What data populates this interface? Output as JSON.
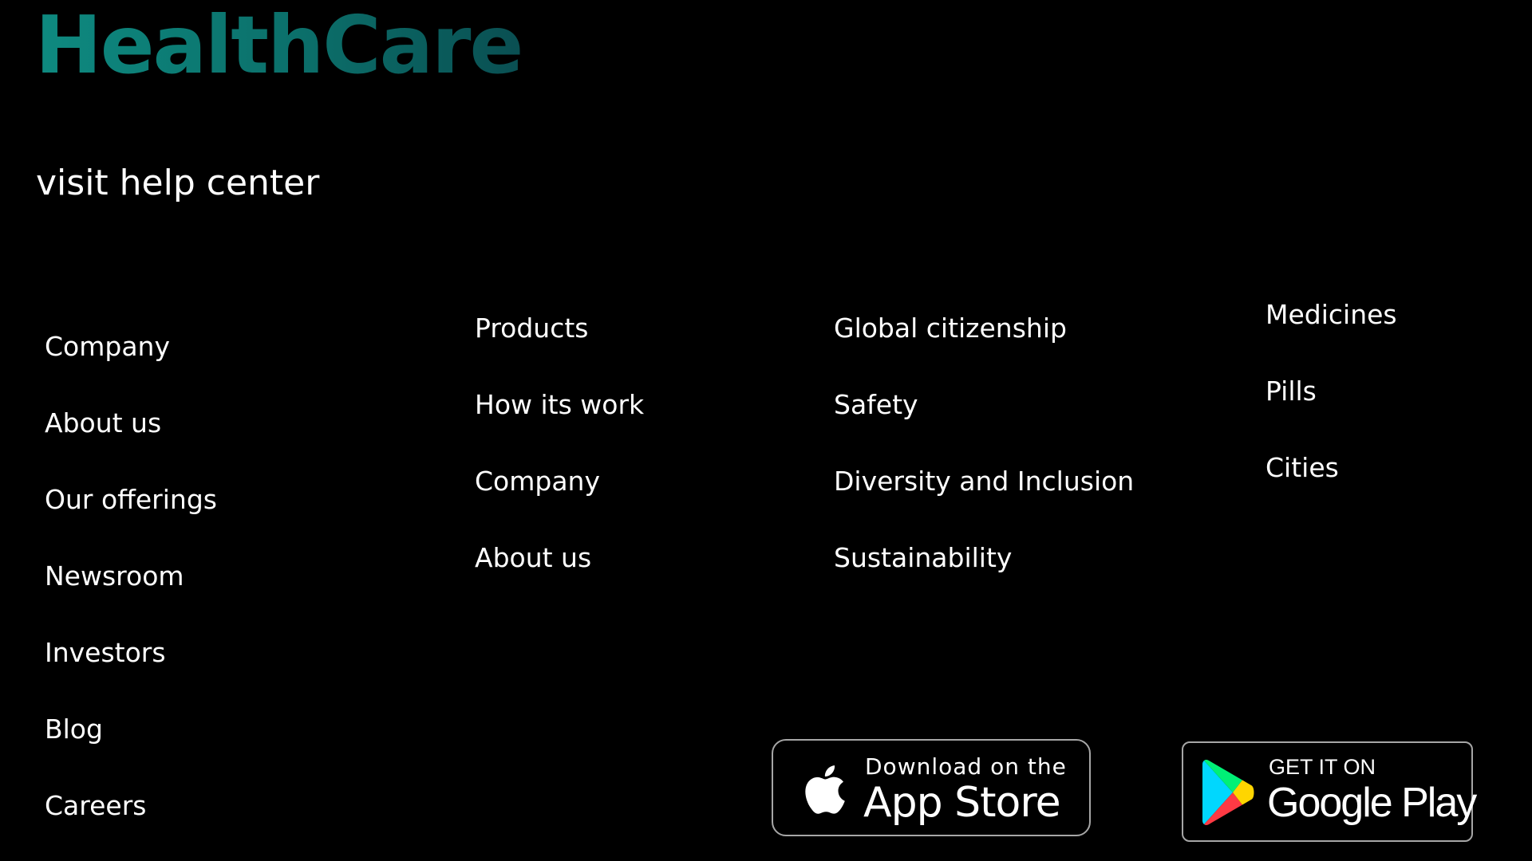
{
  "brand": {
    "name": "HealthCare",
    "gradient_start": "#0e8a80",
    "gradient_end": "#0a4f52"
  },
  "help": {
    "label": "visit help center"
  },
  "footer": {
    "columns": [
      {
        "items": [
          "Company",
          "About us",
          "Our offerings",
          "Newsroom",
          "Investors",
          "Blog",
          "Careers"
        ]
      },
      {
        "items": [
          "Products",
          "How its work",
          "Company",
          "About us"
        ]
      },
      {
        "items": [
          "Global citizenship",
          "Safety",
          "Diversity and Inclusion",
          "Sustainability"
        ]
      },
      {
        "items": [
          "Medicines",
          "Pills",
          "Cities"
        ]
      }
    ]
  },
  "stores": {
    "app_store": {
      "icon": "apple-icon",
      "small": "Download on the",
      "big": "App Store"
    },
    "google_play": {
      "icon": "google-play-icon",
      "small": "GET IT ON",
      "big": "Google Play"
    }
  },
  "colors": {
    "background": "#000000",
    "text": "#ffffff",
    "badge_border": "#a6a6a6"
  }
}
